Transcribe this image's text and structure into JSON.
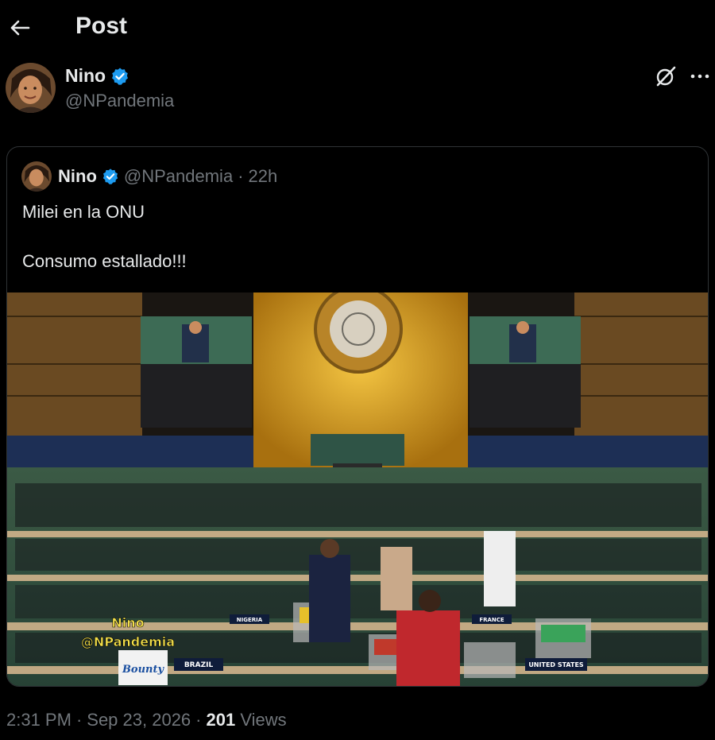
{
  "header": {
    "title": "Post",
    "back_icon": "arrow-left-icon"
  },
  "post": {
    "author_name": "Nino",
    "author_handle": "@NPandemia",
    "verified": true,
    "timestamp": "2:31 PM",
    "date": "Sep 23, 2026",
    "separator": "·",
    "views_count": "201",
    "views_label": "Views"
  },
  "quoted": {
    "author_name": "Nino",
    "author_handle": "@NPandemia",
    "separator": "·",
    "time": "22h",
    "text": "Milei en la ONU\n\nConsumo estallado!!!",
    "media": {
      "watermark_name": "Nino",
      "watermark_handle": "@NPandemia",
      "placards": [
        "BRAZIL",
        "NIGERIA",
        "FRANCE",
        "UNITED STATES"
      ],
      "product": "Bounty"
    }
  },
  "colors": {
    "background": "#000000",
    "text": "#e7e9ea",
    "muted": "#71767b",
    "verified": "#1d9bf0",
    "border": "#2f3336"
  }
}
